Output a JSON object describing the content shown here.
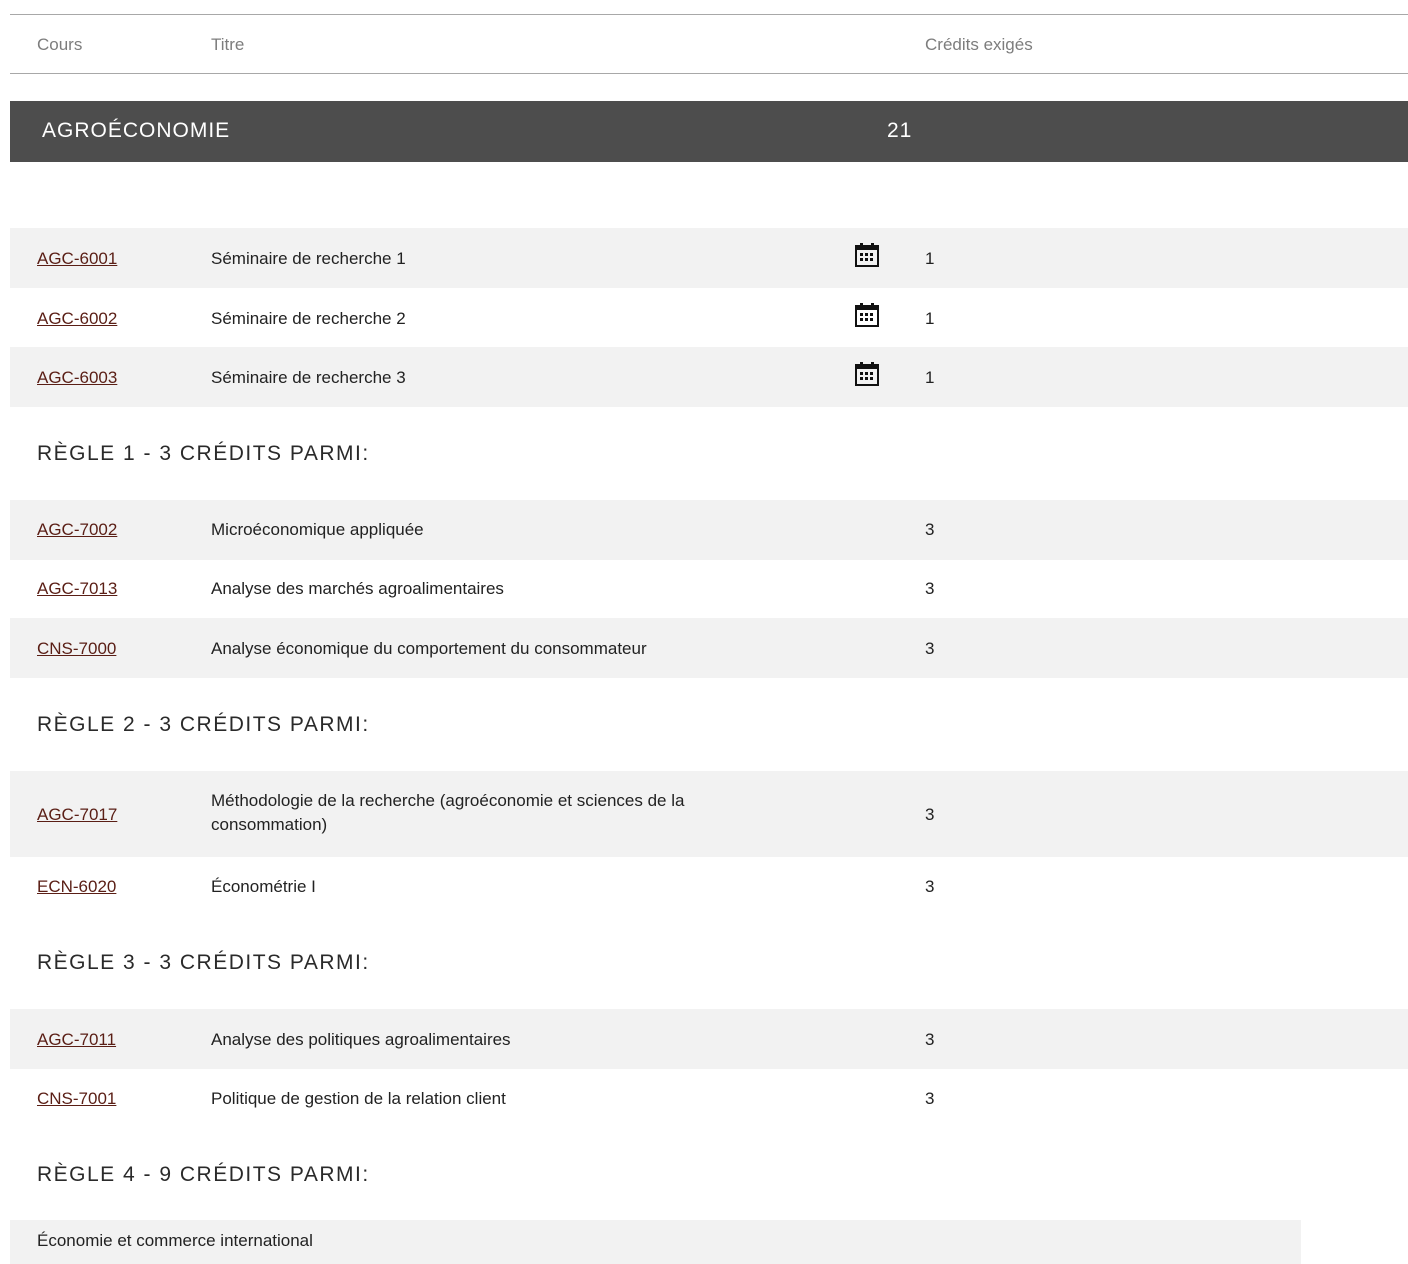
{
  "header": {
    "col_cours": "Cours",
    "col_titre": "Titre",
    "col_credits": "Crédits exigés"
  },
  "section": {
    "title": "AGROÉCONOMIE",
    "credits": "21"
  },
  "mandatory": [
    {
      "code": "AGC-6001",
      "title": "Séminaire de recherche 1",
      "credits": "1",
      "icon": "calendar-icon"
    },
    {
      "code": "AGC-6002",
      "title": "Séminaire de recherche 2",
      "credits": "1",
      "icon": "calendar-icon"
    },
    {
      "code": "AGC-6003",
      "title": "Séminaire de recherche 3",
      "credits": "1",
      "icon": "calendar-icon"
    }
  ],
  "rules": [
    {
      "heading": "RÈGLE 1 - 3 CRÉDITS PARMI:",
      "courses": [
        {
          "code": "AGC-7002",
          "title": "Microéconomique appliquée",
          "credits": "3"
        },
        {
          "code": "AGC-7013",
          "title": "Analyse des marchés agroalimentaires",
          "credits": "3"
        },
        {
          "code": "CNS-7000",
          "title": "Analyse économique du comportement du consommateur",
          "credits": "3"
        }
      ]
    },
    {
      "heading": "RÈGLE 2 - 3 CRÉDITS PARMI:",
      "courses": [
        {
          "code": "AGC-7017",
          "title": "Méthodologie de la recherche (agroéconomie et sciences de la consommation)",
          "credits": "3"
        },
        {
          "code": "ECN-6020",
          "title": "Économétrie I",
          "credits": "3"
        }
      ]
    },
    {
      "heading": "RÈGLE 3 - 3 CRÉDITS PARMI:",
      "courses": [
        {
          "code": "AGC-7011",
          "title": "Analyse des politiques agroalimentaires",
          "credits": "3"
        },
        {
          "code": "CNS-7001",
          "title": "Politique de gestion de la relation client",
          "credits": "3"
        }
      ]
    },
    {
      "heading": "RÈGLE 4 - 9 CRÉDITS PARMI:",
      "subgroup": "Économie et commerce international"
    }
  ],
  "colors": {
    "section_bar": "#4d4d4d",
    "row_shade": "#f2f2f2",
    "link": "#5a1e15"
  }
}
